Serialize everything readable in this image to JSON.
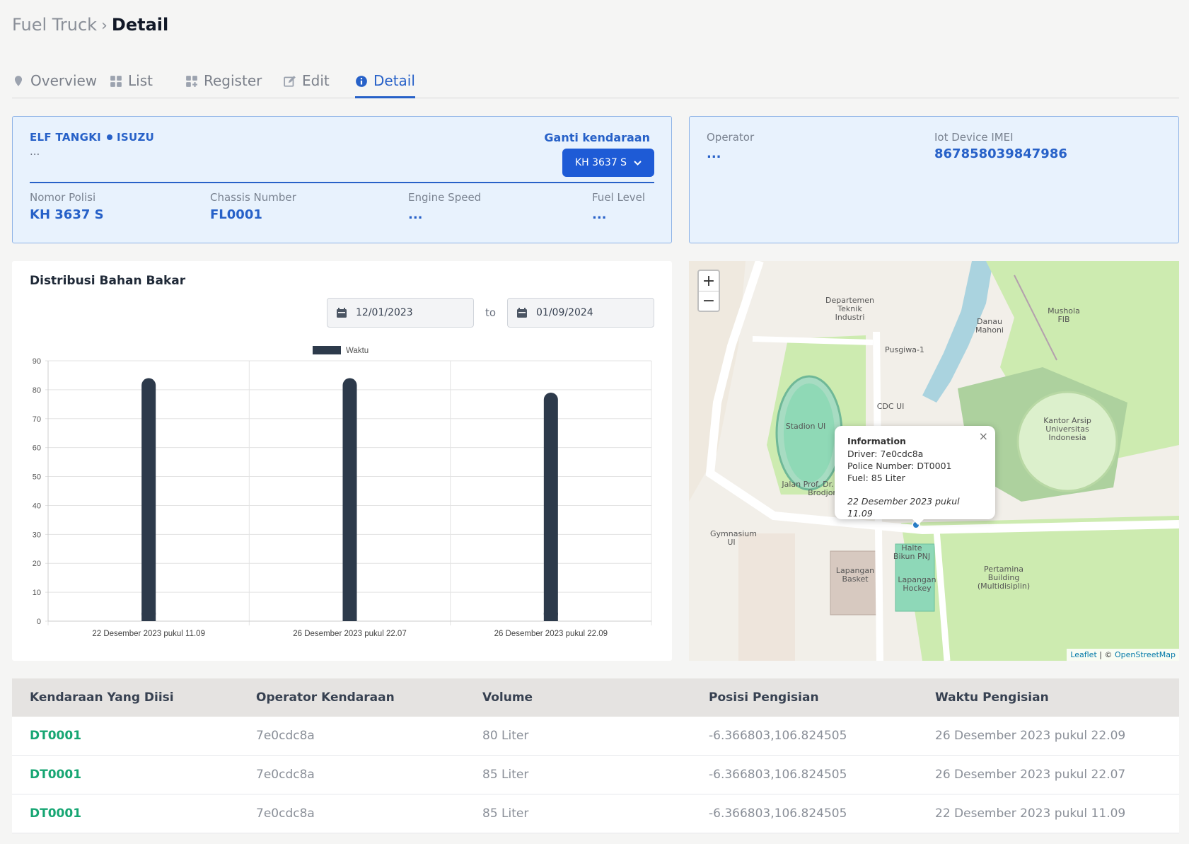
{
  "breadcrumb": {
    "parent": "Fuel Truck",
    "separator": "›",
    "current": "Detail"
  },
  "tabs": [
    {
      "label": "Overview",
      "icon": "map-pin-icon"
    },
    {
      "label": "List",
      "icon": "grid-icon"
    },
    {
      "label": "Register",
      "icon": "grid-plus-icon"
    },
    {
      "label": "Edit",
      "icon": "edit-icon"
    },
    {
      "label": "Detail",
      "icon": "info-icon",
      "active": true
    }
  ],
  "vehicle": {
    "type": "ELF TANGKI",
    "brand": "ISUZU",
    "sub": "...",
    "switch_label": "Ganti kendaraan",
    "selected": "KH 3637 S",
    "fields": [
      {
        "label": "Nomor Polisi",
        "value": "KH 3637 S"
      },
      {
        "label": "Chassis Number",
        "value": "FL0001"
      },
      {
        "label": "Engine Speed",
        "value": "..."
      },
      {
        "label": "Fuel Level",
        "value": "..."
      }
    ]
  },
  "operator_card": {
    "operator_label": "Operator",
    "operator_value": "...",
    "imei_label": "Iot Device IMEI",
    "imei_value": "867858039847986"
  },
  "chart_panel": {
    "title": "Distribusi Bahan Bakar",
    "date_from": "12/01/2023",
    "to_label": "to",
    "date_to": "01/09/2024"
  },
  "chart_data": {
    "type": "bar",
    "categories": [
      "22 Desember 2023 pukul 11.09",
      "26 Desember 2023 pukul 22.07",
      "26 Desember 2023 pukul 22.09"
    ],
    "series": [
      {
        "name": "Waktu",
        "values": [
          84,
          84,
          79
        ]
      }
    ],
    "ylim": [
      0,
      90
    ],
    "yticks": [
      0,
      10,
      20,
      30,
      40,
      50,
      60,
      70,
      80,
      90
    ],
    "grid": true,
    "legend": "top-center",
    "color": "#2d3a4b"
  },
  "map": {
    "zoom_in": "+",
    "zoom_out": "−",
    "popup": {
      "title": "Information",
      "driver": "Driver: 7e0cdc8a",
      "police": "Police Number: DT0001",
      "fuel": "Fuel: 85 Liter",
      "time": "22 Desember 2023 pukul 11.09",
      "close": "×"
    },
    "attribution_leaflet": "Leaflet",
    "attribution_sep": " | © ",
    "attribution_osm": "OpenStreetMap",
    "labels": [
      "Stadion UI",
      "Danau Mahoni",
      "Pusgiwa-1",
      "CDC UI",
      "Kantor Arsip Universitas Indonesia",
      "Jalan Prof. Dr. Ir. Soemantri Brodjonegoro",
      "Halte Bikun PNJ",
      "Lapangan Basket",
      "Lapangan Hockey",
      "Gymnasium UI",
      "Pertamina Building (Multidisiplin)",
      "Mushola FIB",
      "Departemen Teknik Industri"
    ]
  },
  "table": {
    "headers": [
      "Kendaraan Yang Diisi",
      "Operator Kendaraan",
      "Volume",
      "Posisi Pengisian",
      "Waktu Pengisian"
    ],
    "rows": [
      [
        "DT0001",
        "7e0cdc8a",
        "80 Liter",
        "-6.366803,106.824505",
        "26 Desember 2023 pukul 22.09"
      ],
      [
        "DT0001",
        "7e0cdc8a",
        "85 Liter",
        "-6.366803,106.824505",
        "26 Desember 2023 pukul 22.07"
      ],
      [
        "DT0001",
        "7e0cdc8a",
        "85 Liter",
        "-6.366803,106.824505",
        "22 Desember 2023 pukul 11.09"
      ]
    ]
  }
}
